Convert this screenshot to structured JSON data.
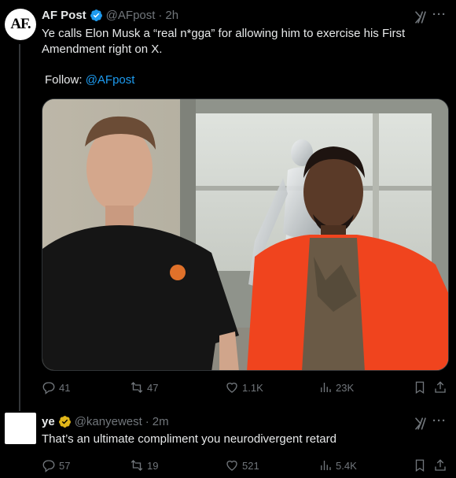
{
  "tweet1": {
    "author": {
      "name": "AF Post",
      "handle": "@AFpost",
      "avatar_text": "AF.",
      "verified": true
    },
    "time": "2h",
    "dot": "·",
    "text": "Ye calls Elon Musk a “real n*gga” for allowing him to exercise his First Amendment right on X.",
    "follow_label": "Follow: ",
    "follow_handle": "@AFpost",
    "stats": {
      "replies": "41",
      "reposts": "47",
      "likes": "1.1K",
      "views": "23K"
    }
  },
  "tweet2": {
    "author": {
      "name": "ye",
      "handle": "@kanyewest",
      "verified": true
    },
    "time": "2m",
    "dot": "·",
    "text": "That’s an ultimate compliment you neurodivergent retard",
    "stats": {
      "replies": "57",
      "reposts": "19",
      "likes": "521",
      "views": "5.4K"
    }
  },
  "colors": {
    "background": "#000000",
    "text": "#e7e9ea",
    "muted": "#71767b",
    "link": "#1d9bf0",
    "verified_blue": "#1d9bf0",
    "verified_gold": "#e2b719"
  },
  "icons": [
    "verified-badge-icon",
    "grok-icon",
    "more-icon",
    "reply-icon",
    "repost-icon",
    "like-icon",
    "views-icon",
    "bookmark-icon",
    "share-icon"
  ]
}
